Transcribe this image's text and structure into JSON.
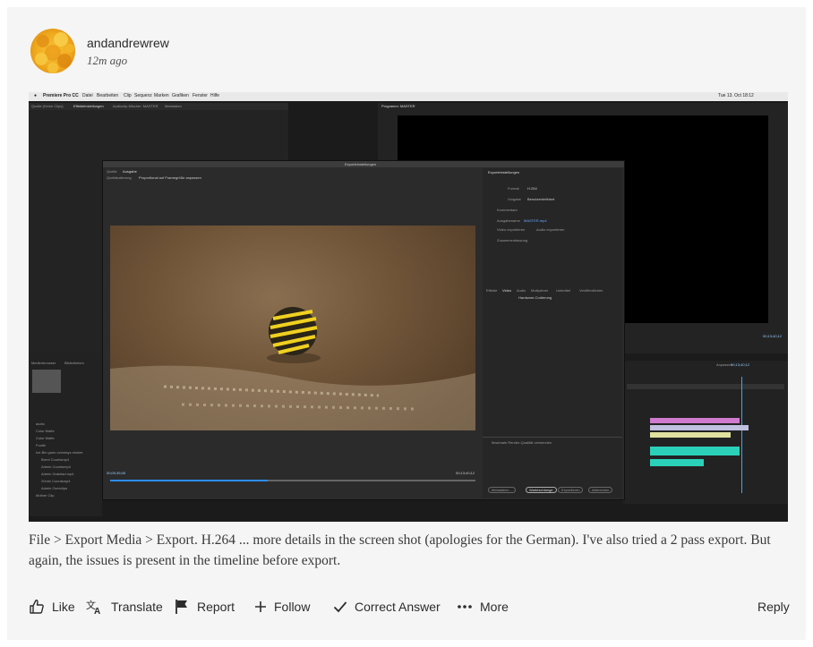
{
  "post": {
    "username": "andandrewrew",
    "timestamp": "12m ago",
    "caption": "File > Export Media > Export. H.264 ... more details in the screen shot (apologies for the German). I've also tried a 2 pass export. But again, the issues is present in the timeline before export."
  },
  "screenshot": {
    "menubar": {
      "app": "Premiere Pro CC",
      "items": [
        "Datei",
        "Bearbeiten",
        "Clip",
        "Sequenz",
        "Marken",
        "Grafiken",
        "Fenster",
        "Hilfe"
      ],
      "clock": "Tue 13. Oct 18:12"
    },
    "dialog_title": "Exporteinstellungen",
    "dialog_tabs": [
      "Quelle",
      "Ausgabe"
    ],
    "source_label": "Quellskalierung",
    "source_value": "Proportional auf Framegröße anpassen",
    "settings_header": "Exporteinstellungen",
    "format_label": "Format",
    "format_value": "H.264",
    "preset_label": "Vorgabe",
    "preset_value": "Benutzerdefiniert",
    "comments_label": "Kommentare",
    "output_label": "Ausgabename",
    "output_value": "MASTER.mp4",
    "export_video": "Video exportieren",
    "export_audio": "Audio exportieren",
    "summary_label": "Zusammenfassung",
    "settings_tabs": [
      "Effekte",
      "Video",
      "Audio",
      "Multiplexer",
      "Untertitel",
      "Veröffentlichen"
    ],
    "encoding_value": "Hardware-Codierung",
    "timecode_start": "00;00;35;05",
    "timecode_end": "00;13;40;12",
    "timeline_timecode": "00;13;40;12",
    "fit_label": "Anpassen",
    "buttons": [
      "Metadaten…",
      "Warteschlange",
      "Exportieren",
      "Abbrechen"
    ],
    "quality_option": "Maximale Render-Qualität verwenden",
    "bin_items": [
      "audio",
      "Color Matte",
      "Color Matte",
      "Footie",
      "Ice-Bin goes overdays shoker",
      "Brent Countsmp4",
      "Admin Countsmp4",
      "Admin Gratzlad.mp4",
      "20min Countsmp4",
      "Admin Overclips",
      "Mother Clip"
    ],
    "panel_tabs": [
      "Quelle (Keine Clips)",
      "Effekteinstellungen",
      "Audioclip-Mischer: MASTER",
      "Metadaten"
    ],
    "program_label": "Programm: MASTER",
    "media_browser": "Medienbrowser",
    "libraries": "Bibliotheken"
  },
  "actions": {
    "like": "Like",
    "translate": "Translate",
    "report": "Report",
    "follow": "Follow",
    "correct_answer": "Correct Answer",
    "more": "More",
    "reply": "Reply"
  },
  "colors": {
    "card_bg": "#f5f5f5",
    "text": "#2c2c2c",
    "avatar": "#f0a91e"
  },
  "icons": [
    "thumbs-up-icon",
    "translate-icon",
    "flag-icon",
    "plus-icon",
    "checkmark-icon",
    "ellipsis-icon"
  ]
}
